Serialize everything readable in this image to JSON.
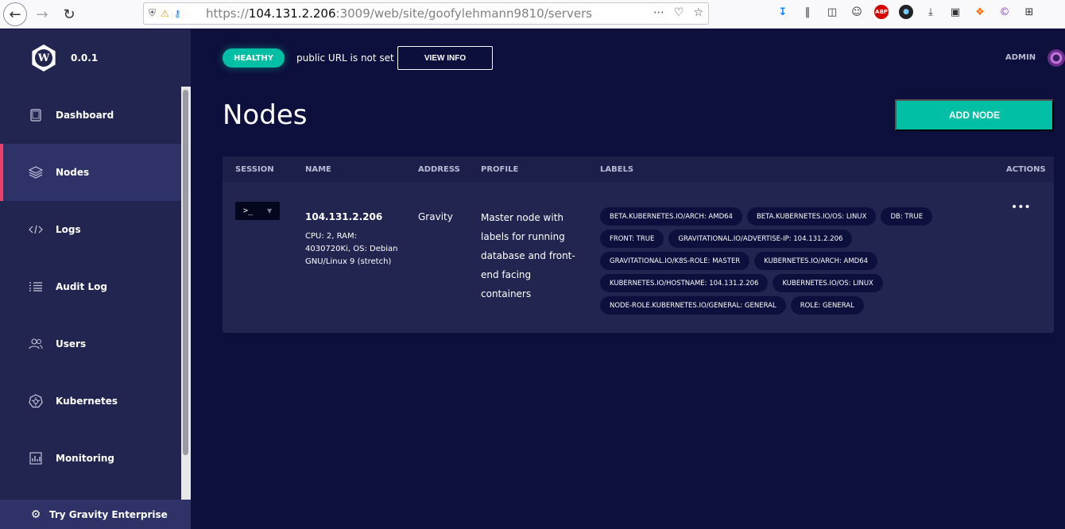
{
  "browser": {
    "url_scheme": "https://",
    "url_host": "104.131.2.206",
    "url_path": ":3009/web/site/goofylehmann9810/servers",
    "abp_label": "ABP"
  },
  "sidebar": {
    "version": "0.0.1",
    "logo_letter": "W",
    "items": [
      {
        "label": "Dashboard",
        "icon": "tablet-icon"
      },
      {
        "label": "Nodes",
        "icon": "layers-icon",
        "active": true
      },
      {
        "label": "Logs",
        "icon": "code-icon"
      },
      {
        "label": "Audit Log",
        "icon": "list-icon"
      },
      {
        "label": "Users",
        "icon": "users-icon"
      },
      {
        "label": "Kubernetes",
        "icon": "kubernetes-icon"
      },
      {
        "label": "Monitoring",
        "icon": "chart-icon"
      }
    ],
    "enterprise_label": "Try Gravity Enterprise"
  },
  "header": {
    "health_status": "HEALTHY",
    "url_status": "public URL is not set",
    "view_info_label": "VIEW INFO",
    "user_label": "ADMIN"
  },
  "page": {
    "title": "Nodes",
    "add_node_label": "ADD NODE"
  },
  "table": {
    "columns": {
      "session": "SESSION",
      "name": "NAME",
      "address": "ADDRESS",
      "profile": "PROFILE",
      "labels": "LABELS",
      "actions": "ACTIONS"
    },
    "row": {
      "session_prompt": ">_",
      "name": "104.131.2.206",
      "specs": "CPU: 2, RAM: 4030720Ki, OS: Debian GNU/Linux 9 (stretch)",
      "address": "Gravity",
      "profile": "Master node with labels for running database and front-end facing containers",
      "labels": [
        "BETA.KUBERNETES.IO/ARCH: AMD64",
        "BETA.KUBERNETES.IO/OS: LINUX",
        "DB: TRUE",
        "FRONT: TRUE",
        "GRAVITATIONAL.IO/ADVERTISE-IP: 104.131.2.206",
        "GRAVITATIONAL.IO/K8S-ROLE: MASTER",
        "KUBERNETES.IO/ARCH: AMD64",
        "KUBERNETES.IO/HOSTNAME: 104.131.2.206",
        "KUBERNETES.IO/OS: LINUX",
        "NODE-ROLE.KUBERNETES.IO/GENERAL: GENERAL",
        "ROLE: GENERAL"
      ],
      "actions_label": "•••"
    }
  },
  "colors": {
    "accent": "#00bfa5",
    "sidebar_bg": "#222550",
    "main_bg": "#0d0f3c",
    "active_marker": "#e8416b"
  }
}
